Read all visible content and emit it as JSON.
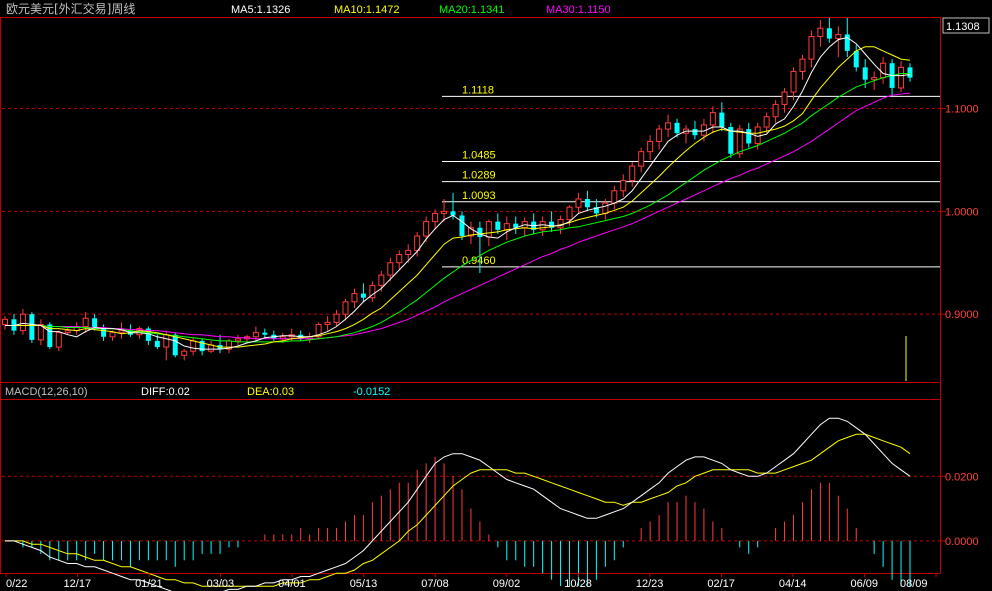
{
  "header": {
    "title": "欧元美元[外汇交易]周线",
    "ma5": "MA5:1.1326",
    "ma10": "MA10:1.1472",
    "ma20": "MA20:1.1341",
    "ma30": "MA30:1.1150"
  },
  "macd_header": {
    "label": "MACD(12,26,10)",
    "diff": "DIFF:0.02",
    "dea": "DEA:0.03",
    "hist": "-0.0152"
  },
  "price_box": "1.1308",
  "colors": {
    "up": "#ff3b3b",
    "down": "#00ffff",
    "ma5": "#ffffff",
    "ma10": "#ffff00",
    "ma20": "#00ff00",
    "ma30": "#ff00ff",
    "grid": "#c00000",
    "axis": "#c00000"
  },
  "chart_data": {
    "type": "candlestick",
    "y_ticks": [
      "1.1000",
      "1.0000",
      "0.9000"
    ],
    "macd_ticks": [
      "0.0200",
      "0.0000"
    ],
    "ylim": [
      0.835,
      1.188
    ],
    "x_labels": [
      "0/22",
      "12/17",
      "01/21",
      "03/03",
      "04/01",
      "05/13",
      "07/08",
      "09/02",
      "10/28",
      "12/23",
      "02/17",
      "04/14",
      "06/09",
      "08/09"
    ],
    "levels": [
      {
        "label": "1.1118",
        "value": 1.1118
      },
      {
        "label": "1.0485",
        "value": 1.0485
      },
      {
        "label": "1.0289",
        "value": 1.0289
      },
      {
        "label": "1.0093",
        "value": 1.0093
      },
      {
        "label": "0.9460",
        "value": 0.946
      }
    ],
    "candles": [
      [
        0.89,
        0.898,
        0.885,
        0.895
      ],
      [
        0.895,
        0.9,
        0.88,
        0.884
      ],
      [
        0.884,
        0.905,
        0.88,
        0.9
      ],
      [
        0.9,
        0.902,
        0.872,
        0.875
      ],
      [
        0.875,
        0.895,
        0.87,
        0.89
      ],
      [
        0.89,
        0.892,
        0.866,
        0.868
      ],
      [
        0.868,
        0.884,
        0.864,
        0.882
      ],
      [
        0.882,
        0.888,
        0.88,
        0.884
      ],
      [
        0.884,
        0.892,
        0.88,
        0.888
      ],
      [
        0.888,
        0.902,
        0.882,
        0.896
      ],
      [
        0.896,
        0.9,
        0.884,
        0.886
      ],
      [
        0.886,
        0.89,
        0.874,
        0.878
      ],
      [
        0.878,
        0.884,
        0.874,
        0.882
      ],
      [
        0.882,
        0.892,
        0.876,
        0.884
      ],
      [
        0.884,
        0.89,
        0.878,
        0.88
      ],
      [
        0.88,
        0.888,
        0.876,
        0.886
      ],
      [
        0.886,
        0.888,
        0.87,
        0.874
      ],
      [
        0.874,
        0.88,
        0.866,
        0.868
      ],
      [
        0.868,
        0.884,
        0.855,
        0.88
      ],
      [
        0.88,
        0.882,
        0.858,
        0.86
      ],
      [
        0.86,
        0.866,
        0.855,
        0.864
      ],
      [
        0.864,
        0.878,
        0.86,
        0.874
      ],
      [
        0.874,
        0.876,
        0.86,
        0.864
      ],
      [
        0.864,
        0.874,
        0.862,
        0.87
      ],
      [
        0.87,
        0.88,
        0.862,
        0.866
      ],
      [
        0.866,
        0.876,
        0.862,
        0.874
      ],
      [
        0.874,
        0.88,
        0.87,
        0.876
      ],
      [
        0.876,
        0.88,
        0.872,
        0.878
      ],
      [
        0.878,
        0.888,
        0.874,
        0.882
      ],
      [
        0.882,
        0.886,
        0.876,
        0.88
      ],
      [
        0.88,
        0.884,
        0.874,
        0.876
      ],
      [
        0.876,
        0.882,
        0.872,
        0.878
      ],
      [
        0.878,
        0.886,
        0.874,
        0.88
      ],
      [
        0.88,
        0.884,
        0.874,
        0.876
      ],
      [
        0.876,
        0.882,
        0.872,
        0.878
      ],
      [
        0.878,
        0.892,
        0.876,
        0.89
      ],
      [
        0.89,
        0.898,
        0.884,
        0.892
      ],
      [
        0.892,
        0.904,
        0.888,
        0.9
      ],
      [
        0.9,
        0.915,
        0.894,
        0.912
      ],
      [
        0.912,
        0.925,
        0.906,
        0.92
      ],
      [
        0.92,
        0.93,
        0.912,
        0.916
      ],
      [
        0.916,
        0.932,
        0.912,
        0.928
      ],
      [
        0.928,
        0.942,
        0.922,
        0.938
      ],
      [
        0.938,
        0.955,
        0.932,
        0.95
      ],
      [
        0.95,
        0.962,
        0.944,
        0.958
      ],
      [
        0.958,
        0.968,
        0.95,
        0.962
      ],
      [
        0.962,
        0.98,
        0.956,
        0.976
      ],
      [
        0.976,
        0.995,
        0.97,
        0.99
      ],
      [
        0.99,
        1.002,
        0.982,
        0.998
      ],
      [
        0.998,
        1.012,
        0.99,
        1.0
      ],
      [
        1.0,
        1.018,
        0.992,
        0.996
      ],
      [
        0.996,
        1.0,
        0.972,
        0.976
      ],
      [
        0.976,
        0.99,
        0.968,
        0.984
      ],
      [
        0.984,
        0.99,
        0.94,
        0.975
      ],
      [
        0.975,
        0.992,
        0.966,
        0.99
      ],
      [
        0.99,
        0.998,
        0.978,
        0.982
      ],
      [
        0.982,
        0.995,
        0.972,
        0.988
      ],
      [
        0.988,
        0.995,
        0.978,
        0.984
      ],
      [
        0.984,
        0.994,
        0.976,
        0.99
      ],
      [
        0.99,
        0.998,
        0.978,
        0.982
      ],
      [
        0.982,
        0.995,
        0.976,
        0.99
      ],
      [
        0.99,
        1.0,
        0.98,
        0.984
      ],
      [
        0.984,
        0.996,
        0.978,
        0.992
      ],
      [
        0.992,
        1.006,
        0.986,
        1.004
      ],
      [
        1.004,
        1.018,
        0.998,
        1.012
      ],
      [
        1.012,
        1.02,
        1.0,
        1.004
      ],
      [
        1.004,
        1.012,
        0.994,
        0.998
      ],
      [
        0.998,
        1.012,
        0.992,
        1.008
      ],
      [
        1.008,
        1.025,
        1.002,
        1.02
      ],
      [
        1.02,
        1.036,
        1.014,
        1.03
      ],
      [
        1.03,
        1.048,
        1.024,
        1.044
      ],
      [
        1.044,
        1.062,
        1.038,
        1.058
      ],
      [
        1.058,
        1.074,
        1.05,
        1.068
      ],
      [
        1.068,
        1.084,
        1.06,
        1.08
      ],
      [
        1.08,
        1.094,
        1.072,
        1.086
      ],
      [
        1.086,
        1.09,
        1.072,
        1.076
      ],
      [
        1.076,
        1.084,
        1.066,
        1.08
      ],
      [
        1.08,
        1.088,
        1.07,
        1.074
      ],
      [
        1.074,
        1.09,
        1.068,
        1.084
      ],
      [
        1.084,
        1.102,
        1.076,
        1.096
      ],
      [
        1.096,
        1.106,
        1.078,
        1.082
      ],
      [
        1.082,
        1.086,
        1.052,
        1.056
      ],
      [
        1.056,
        1.084,
        1.052,
        1.08
      ],
      [
        1.08,
        1.086,
        1.062,
        1.066
      ],
      [
        1.066,
        1.086,
        1.06,
        1.082
      ],
      [
        1.082,
        1.096,
        1.076,
        1.092
      ],
      [
        1.092,
        1.108,
        1.086,
        1.104
      ],
      [
        1.104,
        1.12,
        1.096,
        1.116
      ],
      [
        1.116,
        1.14,
        1.108,
        1.136
      ],
      [
        1.136,
        1.152,
        1.128,
        1.148
      ],
      [
        1.148,
        1.176,
        1.14,
        1.17
      ],
      [
        1.17,
        1.186,
        1.16,
        1.178
      ],
      [
        1.178,
        1.188,
        1.164,
        1.168
      ],
      [
        1.168,
        1.18,
        1.15,
        1.172
      ],
      [
        1.172,
        1.188,
        1.15,
        1.156
      ],
      [
        1.156,
        1.162,
        1.136,
        1.14
      ],
      [
        1.14,
        1.148,
        1.12,
        1.128
      ],
      [
        1.128,
        1.136,
        1.118,
        1.13
      ],
      [
        1.13,
        1.15,
        1.124,
        1.144
      ],
      [
        1.144,
        1.148,
        1.112,
        1.12
      ],
      [
        1.12,
        1.146,
        1.116,
        1.14
      ],
      [
        1.14,
        1.144,
        1.126,
        1.13
      ]
    ],
    "ma5": [
      0.889,
      0.889,
      0.891,
      0.89,
      0.889,
      0.883,
      0.883,
      0.88,
      0.878,
      0.883,
      0.887,
      0.886,
      0.886,
      0.885,
      0.882,
      0.882,
      0.881,
      0.878,
      0.876,
      0.874,
      0.869,
      0.867,
      0.866,
      0.866,
      0.866,
      0.867,
      0.869,
      0.872,
      0.874,
      0.877,
      0.878,
      0.879,
      0.879,
      0.878,
      0.878,
      0.88,
      0.883,
      0.888,
      0.895,
      0.903,
      0.912,
      0.919,
      0.925,
      0.934,
      0.943,
      0.952,
      0.961,
      0.973,
      0.983,
      0.992,
      0.996,
      0.99,
      0.983,
      0.978,
      0.975,
      0.974,
      0.98,
      0.984,
      0.987,
      0.986,
      0.987,
      0.986,
      0.986,
      0.99,
      0.998,
      1.001,
      1.003,
      1.005,
      1.008,
      1.012,
      1.02,
      1.032,
      1.044,
      1.056,
      1.068,
      1.074,
      1.078,
      1.078,
      1.078,
      1.082,
      1.082,
      1.078,
      1.078,
      1.076,
      1.073,
      1.075,
      1.085,
      1.09,
      1.102,
      1.117,
      1.135,
      1.15,
      1.16,
      1.167,
      1.169,
      1.163,
      1.153,
      1.143,
      1.134,
      1.132,
      1.132,
      1.133
    ],
    "ma10": [
      0.889,
      0.889,
      0.889,
      0.889,
      0.889,
      0.886,
      0.886,
      0.885,
      0.884,
      0.886,
      0.885,
      0.884,
      0.883,
      0.881,
      0.882,
      0.884,
      0.883,
      0.882,
      0.88,
      0.878,
      0.876,
      0.874,
      0.872,
      0.87,
      0.868,
      0.868,
      0.868,
      0.869,
      0.87,
      0.871,
      0.873,
      0.874,
      0.876,
      0.877,
      0.878,
      0.879,
      0.881,
      0.883,
      0.886,
      0.89,
      0.895,
      0.901,
      0.906,
      0.914,
      0.922,
      0.93,
      0.938,
      0.948,
      0.958,
      0.968,
      0.974,
      0.975,
      0.977,
      0.978,
      0.979,
      0.98,
      0.982,
      0.983,
      0.984,
      0.983,
      0.984,
      0.985,
      0.987,
      0.989,
      0.992,
      0.994,
      0.996,
      0.998,
      1.001,
      1.004,
      1.01,
      1.018,
      1.026,
      1.034,
      1.043,
      1.051,
      1.059,
      1.066,
      1.072,
      1.077,
      1.08,
      1.078,
      1.077,
      1.076,
      1.076,
      1.078,
      1.08,
      1.083,
      1.088,
      1.095,
      1.108,
      1.12,
      1.13,
      1.14,
      1.148,
      1.156,
      1.16,
      1.16,
      1.156,
      1.152,
      1.148,
      1.147
    ],
    "ma20": [
      0.889,
      0.889,
      0.889,
      0.889,
      0.889,
      0.888,
      0.888,
      0.887,
      0.887,
      0.887,
      0.886,
      0.886,
      0.886,
      0.885,
      0.884,
      0.883,
      0.882,
      0.881,
      0.88,
      0.879,
      0.878,
      0.877,
      0.876,
      0.875,
      0.874,
      0.874,
      0.873,
      0.873,
      0.873,
      0.873,
      0.873,
      0.873,
      0.874,
      0.874,
      0.875,
      0.876,
      0.877,
      0.878,
      0.88,
      0.882,
      0.885,
      0.888,
      0.892,
      0.897,
      0.902,
      0.908,
      0.914,
      0.921,
      0.928,
      0.935,
      0.941,
      0.947,
      0.952,
      0.957,
      0.962,
      0.966,
      0.97,
      0.973,
      0.976,
      0.978,
      0.98,
      0.981,
      0.982,
      0.984,
      0.985,
      0.987,
      0.989,
      0.991,
      0.993,
      0.995,
      0.998,
      1.002,
      1.006,
      1.011,
      1.016,
      1.022,
      1.028,
      1.034,
      1.04,
      1.045,
      1.05,
      1.054,
      1.058,
      1.061,
      1.064,
      1.068,
      1.072,
      1.076,
      1.081,
      1.086,
      1.093,
      1.099,
      1.105,
      1.111,
      1.116,
      1.121,
      1.124,
      1.127,
      1.13,
      1.132,
      1.134,
      1.134
    ],
    "ma30": [
      0.889,
      0.889,
      0.889,
      0.889,
      0.889,
      0.888,
      0.888,
      0.888,
      0.888,
      0.887,
      0.887,
      0.887,
      0.886,
      0.886,
      0.885,
      0.885,
      0.884,
      0.884,
      0.883,
      0.882,
      0.881,
      0.88,
      0.88,
      0.879,
      0.878,
      0.878,
      0.877,
      0.877,
      0.876,
      0.876,
      0.876,
      0.876,
      0.876,
      0.876,
      0.876,
      0.876,
      0.877,
      0.878,
      0.879,
      0.88,
      0.882,
      0.884,
      0.886,
      0.889,
      0.892,
      0.895,
      0.899,
      0.903,
      0.907,
      0.912,
      0.916,
      0.92,
      0.924,
      0.928,
      0.932,
      0.936,
      0.94,
      0.944,
      0.948,
      0.952,
      0.956,
      0.959,
      0.963,
      0.966,
      0.97,
      0.973,
      0.976,
      0.979,
      0.982,
      0.985,
      0.988,
      0.992,
      0.996,
      1.0,
      1.004,
      1.008,
      1.012,
      1.016,
      1.02,
      1.024,
      1.028,
      1.032,
      1.035,
      1.039,
      1.042,
      1.046,
      1.05,
      1.054,
      1.058,
      1.063,
      1.068,
      1.074,
      1.08,
      1.086,
      1.092,
      1.098,
      1.102,
      1.106,
      1.11,
      1.113,
      1.114,
      1.115
    ],
    "macd": {
      "diff": [
        0.0,
        0.0,
        -0.001,
        -0.002,
        -0.003,
        -0.005,
        -0.006,
        -0.007,
        -0.007,
        -0.008,
        -0.008,
        -0.009,
        -0.01,
        -0.011,
        -0.012,
        -0.012,
        -0.013,
        -0.014,
        -0.015,
        -0.016,
        -0.016,
        -0.016,
        -0.016,
        -0.016,
        -0.016,
        -0.015,
        -0.015,
        -0.014,
        -0.014,
        -0.013,
        -0.013,
        -0.012,
        -0.012,
        -0.011,
        -0.011,
        -0.01,
        -0.009,
        -0.008,
        -0.007,
        -0.005,
        -0.003,
        0.0,
        0.003,
        0.006,
        0.009,
        0.012,
        0.016,
        0.02,
        0.024,
        0.026,
        0.027,
        0.027,
        0.026,
        0.025,
        0.023,
        0.021,
        0.019,
        0.018,
        0.017,
        0.016,
        0.014,
        0.012,
        0.01,
        0.009,
        0.008,
        0.007,
        0.007,
        0.008,
        0.009,
        0.01,
        0.012,
        0.014,
        0.016,
        0.018,
        0.021,
        0.023,
        0.025,
        0.026,
        0.026,
        0.025,
        0.024,
        0.022,
        0.021,
        0.02,
        0.02,
        0.021,
        0.023,
        0.025,
        0.027,
        0.03,
        0.033,
        0.036,
        0.038,
        0.038,
        0.037,
        0.035,
        0.033,
        0.03,
        0.027,
        0.024,
        0.022,
        0.02
      ],
      "dea": [
        0.0,
        0.0,
        0.0,
        -0.001,
        -0.001,
        -0.002,
        -0.003,
        -0.004,
        -0.004,
        -0.005,
        -0.006,
        -0.006,
        -0.007,
        -0.008,
        -0.008,
        -0.009,
        -0.01,
        -0.011,
        -0.012,
        -0.012,
        -0.013,
        -0.013,
        -0.014,
        -0.014,
        -0.014,
        -0.014,
        -0.014,
        -0.014,
        -0.014,
        -0.014,
        -0.014,
        -0.013,
        -0.013,
        -0.013,
        -0.012,
        -0.012,
        -0.011,
        -0.01,
        -0.01,
        -0.009,
        -0.007,
        -0.006,
        -0.004,
        -0.002,
        0.0,
        0.003,
        0.005,
        0.008,
        0.011,
        0.014,
        0.017,
        0.019,
        0.021,
        0.022,
        0.022,
        0.022,
        0.022,
        0.021,
        0.021,
        0.02,
        0.019,
        0.018,
        0.017,
        0.016,
        0.015,
        0.014,
        0.013,
        0.012,
        0.012,
        0.011,
        0.012,
        0.012,
        0.013,
        0.014,
        0.015,
        0.017,
        0.018,
        0.02,
        0.021,
        0.022,
        0.022,
        0.022,
        0.022,
        0.022,
        0.021,
        0.021,
        0.021,
        0.022,
        0.023,
        0.024,
        0.025,
        0.027,
        0.029,
        0.031,
        0.032,
        0.033,
        0.033,
        0.032,
        0.031,
        0.03,
        0.029,
        0.027
      ]
    }
  }
}
